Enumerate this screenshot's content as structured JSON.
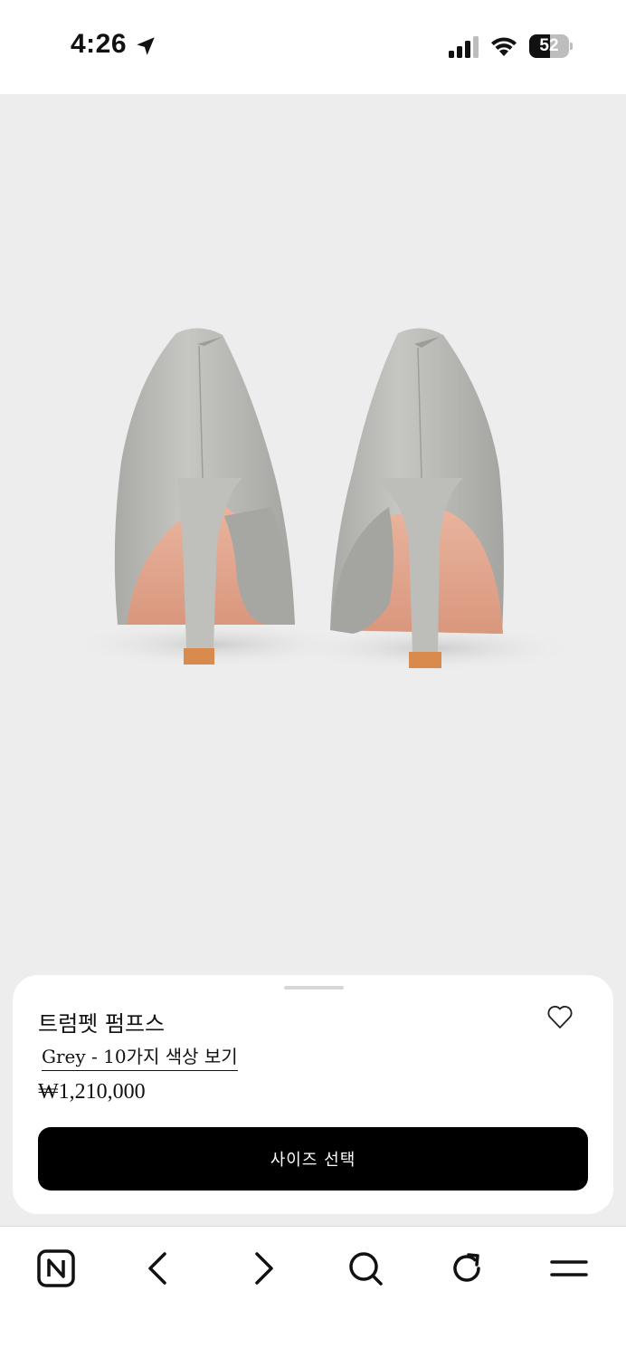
{
  "status_bar": {
    "time": "4:26",
    "battery_level": "52",
    "battery_fraction": 0.52
  },
  "product": {
    "image_description_icon": "product-photo",
    "name": "트럼펫 펌프스",
    "color_link": "Grey - 10가지 색상 보기",
    "price": "₩1,210,000",
    "size_button_label": "사이즈 선택"
  },
  "nav": {
    "items": [
      "home-n-icon",
      "back-icon",
      "forward-icon",
      "search-icon",
      "refresh-icon",
      "menu-icon"
    ]
  },
  "colors": {
    "background_image": "#ededed",
    "button": "#000000",
    "shoe_grey": "#b9b9b6",
    "sole": "#e2a58d"
  }
}
